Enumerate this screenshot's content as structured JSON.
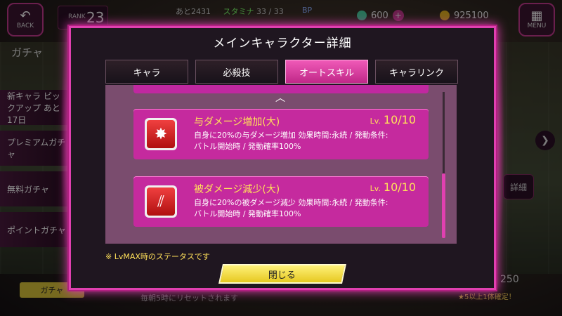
{
  "background": {
    "back_label": "BACK",
    "menu_label": "MENU",
    "rank_label": "RANK",
    "rank_value": "23",
    "stamina_prefix": "あと2431",
    "stamina_label": "スタミナ",
    "stamina_value": "33 / 33",
    "bp_label": "BP",
    "currency1": "600",
    "currency2": "925100",
    "side_title": "ガチャ",
    "side_items": [
      "新キャラ ピックアップ あと17日",
      "プレミアムガチャ",
      "無料ガチャ",
      "ポイントガチャ"
    ],
    "detail_label": "詳細",
    "gacha_button": "ガチャ",
    "bottom_note": "毎朝5時にリセットされます",
    "bottom_count": "250",
    "bottom_confirm": "★5以上1体確定！"
  },
  "modal": {
    "title": "メインキャラクター詳細",
    "tabs": [
      {
        "label": "キャラ",
        "active": false
      },
      {
        "label": "必殺技",
        "active": false
      },
      {
        "label": "オートスキル",
        "active": true
      },
      {
        "label": "キャラリンク",
        "active": false
      }
    ],
    "skills": [
      {
        "icon": "explosion-icon",
        "name": "与ダメージ増加(大)",
        "lv_label": "Lv.",
        "lv_value": "10/10",
        "desc_line1": "自身に20%の与ダメージ増加 効果時間:永続 / 発動条件:",
        "desc_line2": "バトル開始時 / 発動確率100%"
      },
      {
        "icon": "claw-slash-icon",
        "name": "被ダメージ減少(大)",
        "lv_label": "Lv.",
        "lv_value": "10/10",
        "desc_line1": "自身に20%の被ダメージ減少 効果時間:永続 / 発動条件:",
        "desc_line2": "バトル開始時 / 発動確率100%"
      }
    ],
    "note": "※ LvMAX時のステータスです",
    "close_label": "閉じる"
  },
  "colors": {
    "accent": "#e040b0",
    "card": "#c52a9e",
    "level_text": "#ffe05a",
    "close_button": "#f0dc3a"
  }
}
